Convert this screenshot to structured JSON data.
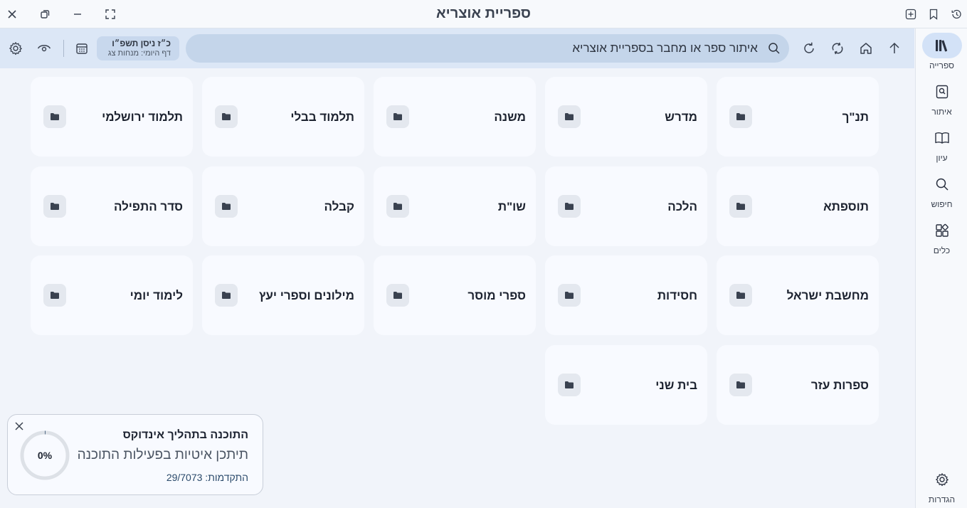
{
  "window": {
    "title": "ספריית אוצריא"
  },
  "titlebar": {
    "left_buttons": [
      "close-icon",
      "restore-icon",
      "minimize-icon",
      "fullscreen-icon"
    ],
    "right_buttons": [
      "add-tab-icon",
      "bookmark-icon",
      "history-icon"
    ]
  },
  "toolbar": {
    "search_placeholder": "איתור ספר או מחבר בספריית אוצריא",
    "date_hebrew": "כ״ז ניסן תשפ״ו",
    "daf_yomi": "דף היומי: מנחות צג"
  },
  "sidebar": {
    "items": [
      {
        "label": "ספרייה",
        "icon": "library-icon",
        "active": true
      },
      {
        "label": "איתור",
        "icon": "find-book-icon",
        "active": false
      },
      {
        "label": "עיון",
        "icon": "book-open-icon",
        "active": false
      },
      {
        "label": "חיפוש",
        "icon": "search-icon",
        "active": false
      },
      {
        "label": "כלים",
        "icon": "tools-icon",
        "active": false
      }
    ],
    "settings_label": "הגדרות"
  },
  "categories": [
    "תנ\"ך",
    "מדרש",
    "משנה",
    "תלמוד בבלי",
    "תלמוד ירושלמי",
    "תוספתא",
    "הלכה",
    "שו\"ת",
    "קבלה",
    "סדר התפילה",
    "מחשבת ישראל",
    "חסידות",
    "ספרי מוסר",
    "מילונים וספרי יעץ",
    "לימוד יומי",
    "ספרות עזר",
    "בית שני"
  ],
  "toast": {
    "title": "התוכנה בתהליך אינדוקס",
    "message": "תיתכן איטיות בפעילות התוכנה",
    "progress_label": "התקדמות: 29/7073",
    "percent_text": "0%",
    "progress_fraction": 0.004
  },
  "colors": {
    "accent": "#d3e2f7",
    "toolbar_bg": "#dce7f6",
    "search_bg": "#c4d5ea",
    "card_bg": "#f8faff"
  }
}
